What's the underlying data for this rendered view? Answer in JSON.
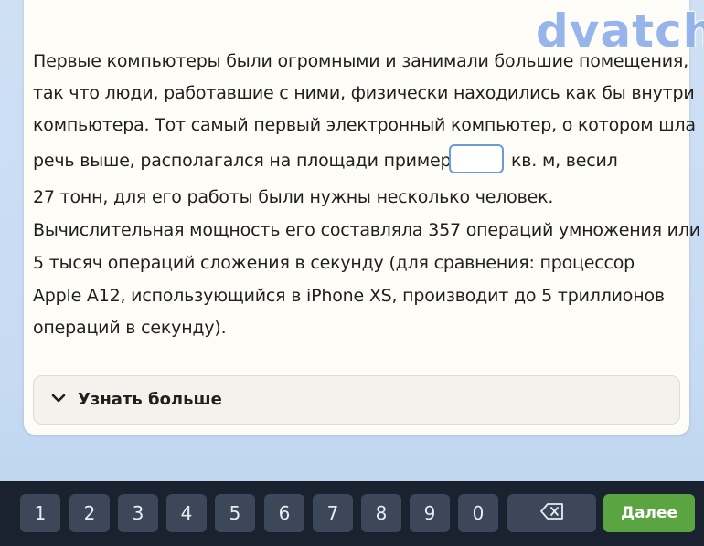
{
  "watermark": {
    "text": "dvatch"
  },
  "passage": {
    "line1": "Первые компьютеры были огромными и занимали большие помещения,",
    "line2": "так что люди, работавшие с ними, физически находились как бы внутри",
    "line3": "компьютера. Тот самый первый электронный компьютер, о котором шла",
    "line4_before": "речь выше, располагался на площади примерно",
    "line4_after": "кв. м, весил",
    "line5": "27 тонн, для его работы были нужны несколько человек.",
    "line6": "Вычислительная мощность его составляла 357 операций умножения или",
    "line7": "5 тысяч операций сложения в секунду (для сравнения: процессор",
    "line8": "Apple A12, использующийся в iPhone XS, производит до 5 триллионов",
    "line9": "операций в секунду).",
    "answer_value": ""
  },
  "learn_more": {
    "label": "Узнать больше",
    "icon": "chevron-down-icon"
  },
  "keyboard": {
    "keys": [
      "1",
      "2",
      "3",
      "4",
      "5",
      "6",
      "7",
      "8",
      "9",
      "0"
    ],
    "backspace_icon": "backspace-icon",
    "next_label": "Далее"
  },
  "colors": {
    "accent_green": "#5aa542",
    "keyboard_bg": "#1a2230",
    "key_bg": "#3c4759",
    "input_border": "#6b9bd8"
  }
}
